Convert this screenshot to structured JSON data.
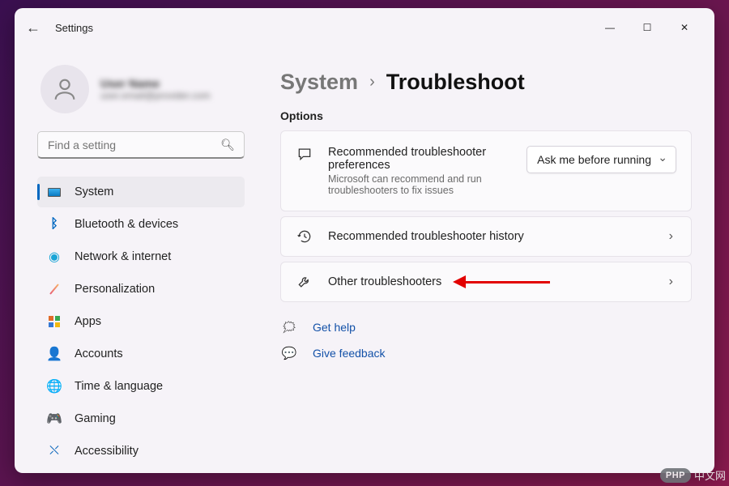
{
  "app_title": "Settings",
  "profile": {
    "name": "User Name",
    "email": "user.email@provider.com"
  },
  "search": {
    "placeholder": "Find a setting"
  },
  "sidebar": {
    "items": [
      {
        "label": "System"
      },
      {
        "label": "Bluetooth & devices"
      },
      {
        "label": "Network & internet"
      },
      {
        "label": "Personalization"
      },
      {
        "label": "Apps"
      },
      {
        "label": "Accounts"
      },
      {
        "label": "Time & language"
      },
      {
        "label": "Gaming"
      },
      {
        "label": "Accessibility"
      }
    ]
  },
  "breadcrumb": {
    "parent": "System",
    "sep": "›",
    "current": "Troubleshoot"
  },
  "options_label": "Options",
  "cards": {
    "prefs": {
      "title": "Recommended troubleshooter preferences",
      "subtitle": "Microsoft can recommend and run troubleshooters to fix issues",
      "dropdown_value": "Ask me before running"
    },
    "history": {
      "title": "Recommended troubleshooter history"
    },
    "other": {
      "title": "Other troubleshooters"
    }
  },
  "help": {
    "get_help": "Get help",
    "give_feedback": "Give feedback"
  },
  "watermark": {
    "badge": "PHP",
    "text": "中文网"
  }
}
